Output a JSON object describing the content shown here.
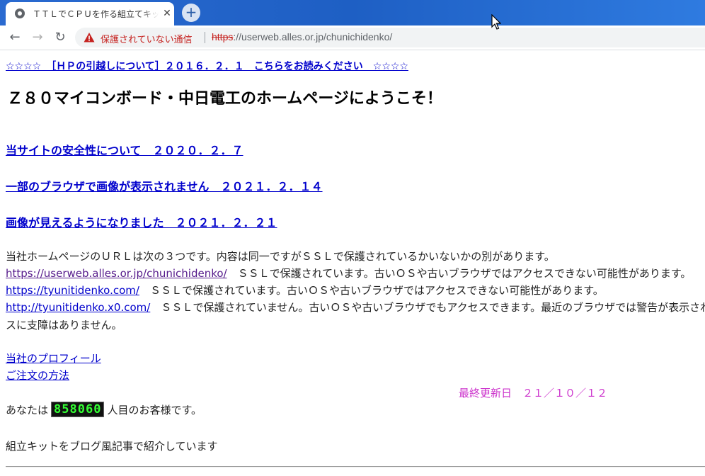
{
  "browser": {
    "tab_title": "ＴＴＬでＣＰＵを作る組立てキット",
    "tab_close": "✕",
    "new_tab": "+",
    "back": "←",
    "forward": "→",
    "reload": "↻",
    "security_label": "保護されていない通信",
    "url_scheme": "https",
    "url_rest": "://userweb.alles.or.jp/chunichidenko/"
  },
  "page": {
    "notice_link": "☆☆☆☆　［ＨＰの引越しについて］２０１６．２．１　こちらをお読みください　☆☆☆☆",
    "heading": "Ｚ８０マイコンボード・中日電工のホームページにようこそ！",
    "news_links": [
      "当サイトの安全性について　２０２０．２．７",
      "一部のブラウザで画像が表示されません　２０２１．２．１４",
      "画像が見えるようになりました　２０２１．２．２１"
    ],
    "url_intro": "当社ホームページのＵＲＬは次の３つです。内容は同一ですがＳＳＬで保護されているかいないかの別があります。",
    "urls": [
      {
        "link": "https://userweb.alles.or.jp/chunichidenko/",
        "desc": "　ＳＳＬで保護されています。古いＯＳや古いブラウザではアクセスできない可能性があります。"
      },
      {
        "link": "https://tyunitidenko.com/",
        "desc": "　ＳＳＬで保護されています。古いＯＳや古いブラウザではアクセスできない可能性があります。"
      },
      {
        "link": "http://tyunitidenko.x0.com/",
        "desc": "　ＳＳＬで保護されていません。古いＯＳや古いブラウザでもアクセスできます。最近のブラウザでは警告が表示されますが、アクセ"
      }
    ],
    "url_note_continued": "スに支障はありません。",
    "profile_link": "当社のプロフィール",
    "order_link": "ご注文の方法",
    "last_updated": "最終更新日　２１／１０／１２",
    "visitor_prefix": "あなたは",
    "visitor_count": "858060",
    "visitor_suffix": "人目のお客様です。",
    "blog_intro": "組立キットをブログ風記事で紹介しています"
  }
}
